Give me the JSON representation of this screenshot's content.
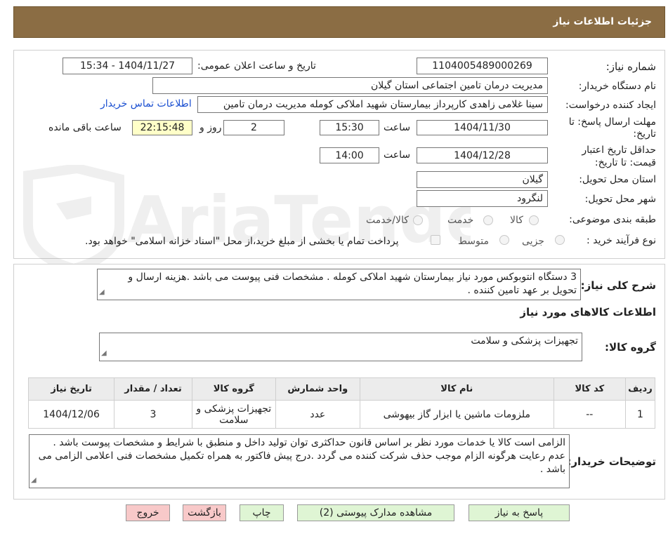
{
  "header": {
    "title": "جزئیات اطلاعات نیاز"
  },
  "form": {
    "need_number_label": "شماره نیاز:",
    "need_number": "1104005489000269",
    "announce_label": "تاریخ و ساعت اعلان عمومی:",
    "announce_value": "1404/11/27 - 15:34",
    "buyer_org_label": "نام دستگاه خریدار:",
    "buyer_org": "مدیریت درمان تامین اجتماعی استان گیلان",
    "requester_label": "ایجاد کننده درخواست:",
    "requester": "سینا غلامی زاهدی کارپرداز بیمارستان شهید املاکی کومله مدیریت درمان تامین",
    "contact_link": "اطلاعات تماس خریدار",
    "deadline_label_1": "مهلت ارسال پاسخ: تا",
    "deadline_label_2": "تاریخ:",
    "deadline_date": "1404/11/30",
    "time_label": "ساعت",
    "deadline_time": "15:30",
    "days_value": "2",
    "days_label": "روز و",
    "remaining_time": "22:15:48",
    "remaining_label": "ساعت باقی مانده",
    "validity_label_1": "حداقل تاریخ اعتبار",
    "validity_label_2": "قیمت: تا تاریخ:",
    "validity_date": "1404/12/28",
    "validity_time": "14:00",
    "province_label": "استان محل تحویل:",
    "province": "گیلان",
    "city_label": "شهر محل تحویل:",
    "city": "لنگرود",
    "category_label": "طبقه بندی موضوعی:",
    "category_options": [
      "کالا",
      "خدمت",
      "کالا/خدمت"
    ],
    "process_label": "نوع فرآیند خرید :",
    "process_options": [
      "جزیی",
      "متوسط"
    ],
    "payment_note": "پرداخت تمام یا بخشی از مبلغ خرید،از محل \"اسناد خزانه اسلامی\" خواهد بود."
  },
  "description": {
    "label": "شرح کلی نیاز:",
    "text": "3 دستگاه انتوبوکس مورد نیاز بیمارستان شهید املاکی کومله . مشخصات فنی پیوست می باشد .هزینه ارسال و تحویل بر عهد تامین کننده ."
  },
  "goods": {
    "section_title": "اطلاعات کالاهای مورد نیاز",
    "group_label": "گروه کالا:",
    "group_value": "تجهیزات پزشکی و سلامت",
    "columns": [
      "ردیف",
      "کد کالا",
      "نام کالا",
      "واحد شمارش",
      "گروه کالا",
      "تعداد / مقدار",
      "تاریخ نیاز"
    ],
    "rows": [
      [
        "1",
        "--",
        "ملزومات ماشین یا ابزار گاز بیهوشی",
        "عدد",
        "تجهیزات پزشکی و سلامت",
        "3",
        "1404/12/06"
      ]
    ]
  },
  "buyer_notes": {
    "label": "توضیحات خریدار:",
    "text": "الزامی است کالا یا خدمات مورد نظر بر اساس قانون حداکثری توان تولید داخل و منطبق با شرایط و مشخصات پیوست باشد . عدم رعایت هرگونه الزام موجب حذف شرکت کننده می گردد .درج پیش فاکتور به همراه تکمیل مشخصات فنی اعلامی الزامی می باشد ."
  },
  "buttons": {
    "respond": "پاسخ به نیاز",
    "attachments": "مشاهده مدارک پیوستی (2)",
    "print": "چاپ",
    "back": "بازگشت",
    "exit": "خروج"
  },
  "watermark": {
    "text": "AriaTender.neT"
  },
  "colors": {
    "header": "#8b6d44",
    "green_button": "#dff5d4",
    "pink_button": "#f8c9c9",
    "remaining_bg": "#ffffc8",
    "link": "#1a4fd1"
  }
}
